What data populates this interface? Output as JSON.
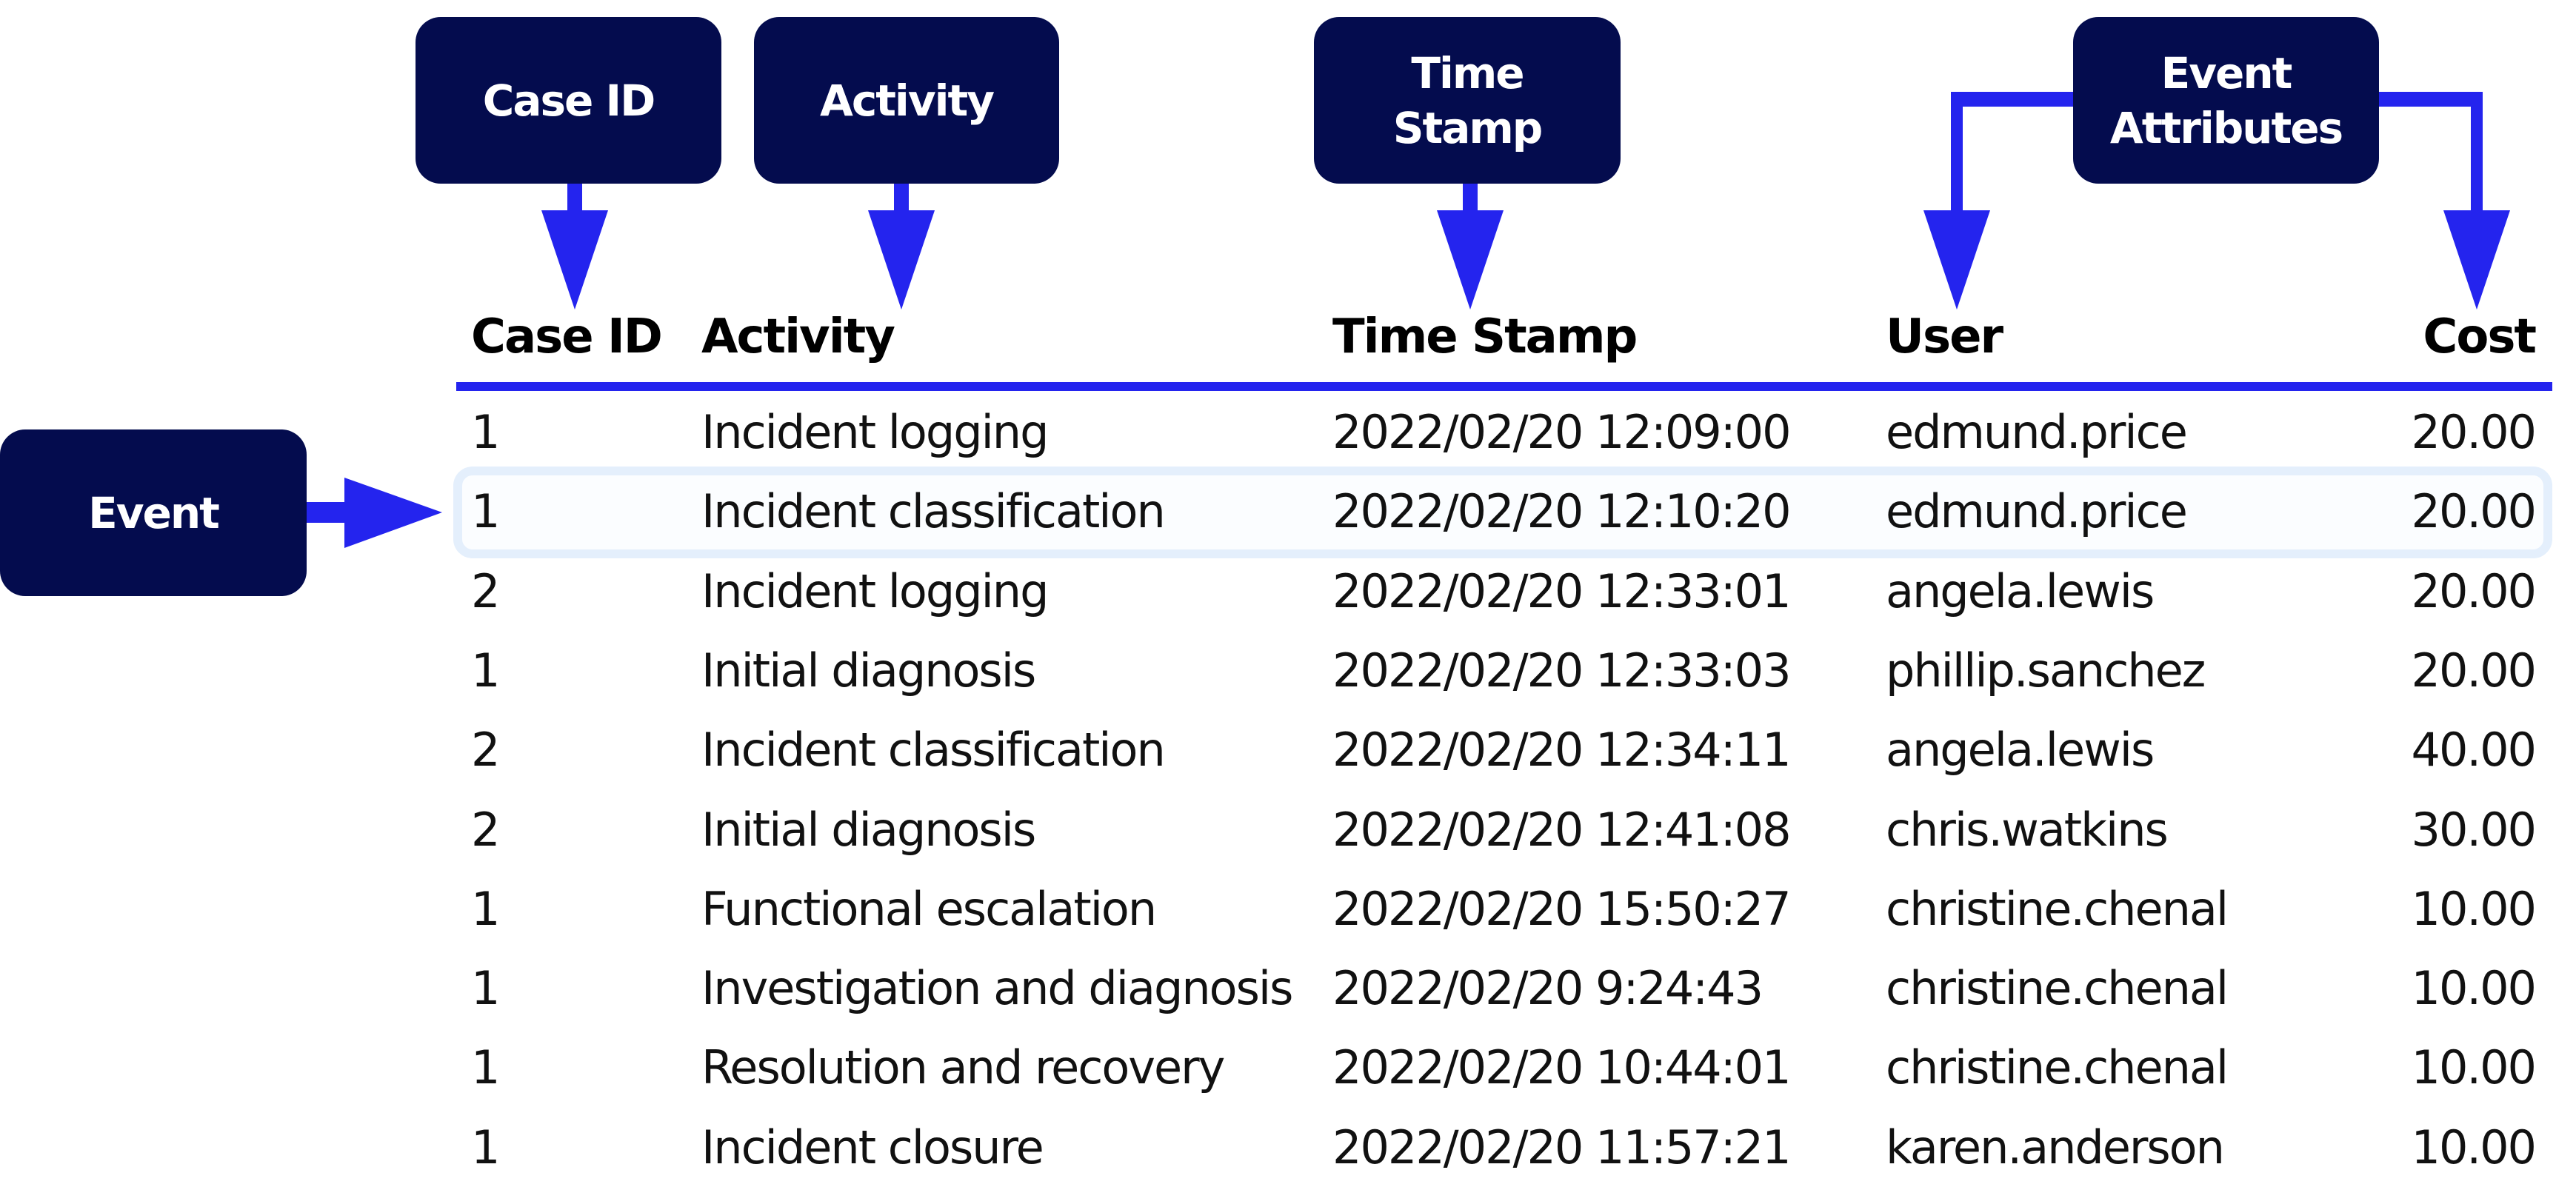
{
  "callouts": {
    "case_id": "Case ID",
    "activity": "Activity",
    "time_stamp": [
      "Time",
      "Stamp"
    ],
    "event_attributes": [
      "Event",
      "Attributes"
    ],
    "event": "Event"
  },
  "colors": {
    "callout_bg": "#040c4e",
    "arrow": "#2424ee",
    "highlight_border": "#e4effc"
  },
  "table": {
    "headers": [
      "Case ID",
      "Activity",
      "Time Stamp",
      "User",
      "Cost"
    ],
    "highlighted_row_index": 1,
    "rows": [
      {
        "case_id": "1",
        "activity": "Incident logging",
        "time_stamp": "2022/02/20 12:09:00",
        "user": "edmund.price",
        "cost": "20.00"
      },
      {
        "case_id": "1",
        "activity": "Incident classification",
        "time_stamp": "2022/02/20 12:10:20",
        "user": "edmund.price",
        "cost": "20.00"
      },
      {
        "case_id": "2",
        "activity": "Incident logging",
        "time_stamp": "2022/02/20 12:33:01",
        "user": "angela.lewis",
        "cost": "20.00"
      },
      {
        "case_id": "1",
        "activity": "Initial diagnosis",
        "time_stamp": "2022/02/20 12:33:03",
        "user": "phillip.sanchez",
        "cost": "20.00"
      },
      {
        "case_id": "2",
        "activity": "Incident classification",
        "time_stamp": "2022/02/20 12:34:11",
        "user": "angela.lewis",
        "cost": "40.00"
      },
      {
        "case_id": "2",
        "activity": "Initial diagnosis",
        "time_stamp": "2022/02/20 12:41:08",
        "user": "chris.watkins",
        "cost": "30.00"
      },
      {
        "case_id": "1",
        "activity": "Functional escalation",
        "time_stamp": "2022/02/20 15:50:27",
        "user": "christine.chenal",
        "cost": "10.00"
      },
      {
        "case_id": "1",
        "activity": "Investigation and diagnosis",
        "time_stamp": "2022/02/20 9:24:43",
        "user": "christine.chenal",
        "cost": "10.00"
      },
      {
        "case_id": "1",
        "activity": "Resolution and recovery",
        "time_stamp": "2022/02/20 10:44:01",
        "user": "christine.chenal",
        "cost": "10.00"
      },
      {
        "case_id": "1",
        "activity": "Incident closure",
        "time_stamp": "2022/02/20 11:57:21",
        "user": "karen.anderson",
        "cost": "10.00"
      }
    ]
  }
}
